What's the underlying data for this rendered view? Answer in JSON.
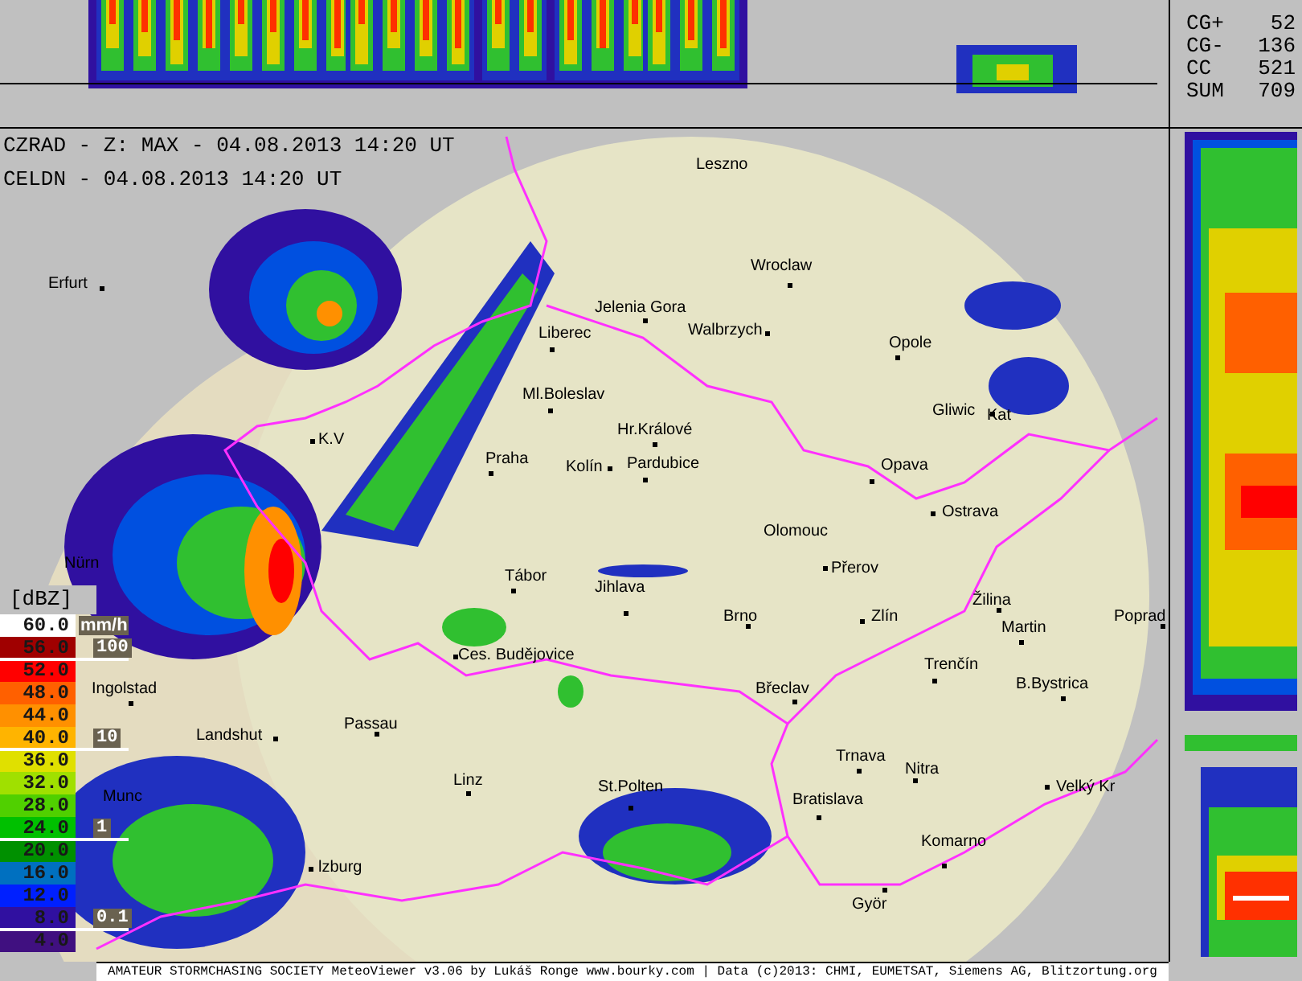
{
  "header": {
    "lines": [
      "CZRAD - Z: MAX - 04.08.2013 14:20 UT",
      "CELDN - 04.08.2013 14:20 UT"
    ]
  },
  "lightning_stats": [
    {
      "label": "CG+",
      "value": "52"
    },
    {
      "label": "CG-",
      "value": "136"
    },
    {
      "label": "CC",
      "value": "521"
    },
    {
      "label": "SUM",
      "value": "709"
    }
  ],
  "legend": {
    "unit": "[dBZ]",
    "rate_unit": "mm/h",
    "rate_marks": [
      "100",
      "10",
      "1",
      "0.1"
    ],
    "levels": [
      {
        "label": "60.0",
        "color": "#ffffff"
      },
      {
        "label": "56.0",
        "color": "#a00000"
      },
      {
        "label": "52.0",
        "color": "#ff0000"
      },
      {
        "label": "48.0",
        "color": "#ff6000"
      },
      {
        "label": "44.0",
        "color": "#ff9000"
      },
      {
        "label": "40.0",
        "color": "#ffb400"
      },
      {
        "label": "36.0",
        "color": "#e0e000"
      },
      {
        "label": "32.0",
        "color": "#a0e000"
      },
      {
        "label": "28.0",
        "color": "#50d000"
      },
      {
        "label": "24.0",
        "color": "#00c000"
      },
      {
        "label": "20.0",
        "color": "#009000"
      },
      {
        "label": "16.0",
        "color": "#0070c0"
      },
      {
        "label": "12.0",
        "color": "#0020ff"
      },
      {
        "label": "8.0",
        "color": "#3010a0"
      },
      {
        "label": "4.0",
        "color": "#401080"
      }
    ]
  },
  "cities": [
    {
      "name": "Leszno"
    },
    {
      "name": "Wroclaw"
    },
    {
      "name": "Erfurt"
    },
    {
      "name": "Jelenia Gora"
    },
    {
      "name": "Liberec"
    },
    {
      "name": "Walbrzych"
    },
    {
      "name": "Opole"
    },
    {
      "name": "Ml.Boleslav"
    },
    {
      "name": "Hr.Králové"
    },
    {
      "name": "Praha"
    },
    {
      "name": "Kolín"
    },
    {
      "name": "Pardubice"
    },
    {
      "name": "K.V"
    },
    {
      "name": "Gliwic"
    },
    {
      "name": "Kat"
    },
    {
      "name": "Opava"
    },
    {
      "name": "Ostrava"
    },
    {
      "name": "Olomouc"
    },
    {
      "name": "Přerov"
    },
    {
      "name": "Tábor"
    },
    {
      "name": "Jihlava"
    },
    {
      "name": "Brno"
    },
    {
      "name": "Zlín"
    },
    {
      "name": "Žilina"
    },
    {
      "name": "Martin"
    },
    {
      "name": "Poprad"
    },
    {
      "name": "Nürn"
    },
    {
      "name": "Ingolstad"
    },
    {
      "name": "Ces. Budějovice"
    },
    {
      "name": "Trenčín"
    },
    {
      "name": "Břeclav"
    },
    {
      "name": "B.Bystrica"
    },
    {
      "name": "Landshut"
    },
    {
      "name": "Passau"
    },
    {
      "name": "Trnava"
    },
    {
      "name": "Nitra"
    },
    {
      "name": "Linz"
    },
    {
      "name": "Munc"
    },
    {
      "name": "St.Polten"
    },
    {
      "name": "Bratislava"
    },
    {
      "name": "Velký Kr"
    },
    {
      "name": "lzburg"
    },
    {
      "name": "Komarno"
    },
    {
      "name": "Györ"
    }
  ],
  "footer": "AMATEUR STORMCHASING SOCIETY MeteoViewer v3.06 by Lukáš Ronge www.bourky.com | Data (c)2013: CHMI, EUMETSAT, Siemens AG, Blitzortung.org"
}
